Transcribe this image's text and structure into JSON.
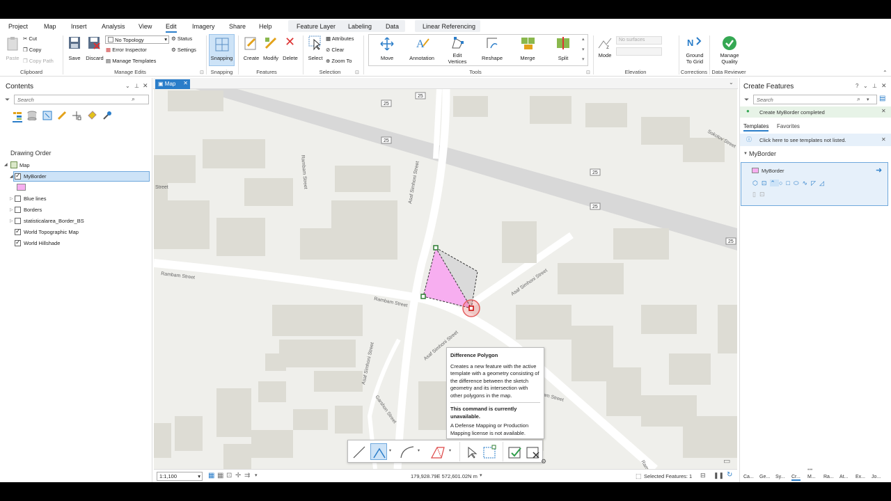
{
  "menu": {
    "tabs": [
      "Project",
      "Map",
      "Insert",
      "Analysis",
      "View",
      "Edit",
      "Imagery",
      "Share",
      "Help"
    ],
    "context_tabs": [
      "Feature Layer",
      "Labeling",
      "Data"
    ],
    "linear_referencing": "Linear Referencing"
  },
  "ribbon": {
    "clipboard": {
      "paste": "Paste",
      "cut": "Cut",
      "copy": "Copy",
      "copy_path": "Copy Path",
      "label": "Clipboard"
    },
    "manage_edits": {
      "save": "Save",
      "discard": "Discard",
      "topology": "No Topology",
      "status": "Status",
      "error_inspector": "Error Inspector",
      "settings": "Settings",
      "manage_templates": "Manage Templates",
      "label": "Manage Edits"
    },
    "snapping": {
      "button": "Snapping",
      "label": "Snapping"
    },
    "features": {
      "create": "Create",
      "modify": "Modify",
      "delete": "Delete",
      "label": "Features"
    },
    "selection": {
      "select": "Select",
      "attributes": "Attributes",
      "clear": "Clear",
      "zoom_to": "Zoom To",
      "label": "Selection"
    },
    "tools": {
      "move": "Move",
      "annotation": "Annotation",
      "edit_vertices_1": "Edit",
      "edit_vertices_2": "Vertices",
      "reshape": "Reshape",
      "merge": "Merge",
      "split": "Split",
      "label": "Tools"
    },
    "elevation": {
      "mode": "Mode",
      "surfaces": "No surfaces",
      "label": "Elevation"
    },
    "corrections": {
      "ground_1": "Ground",
      "ground_2": "To Grid",
      "label": "Corrections"
    },
    "data_reviewer": {
      "manage_1": "Manage",
      "manage_2": "Quality",
      "label": "Data Reviewer"
    }
  },
  "contents": {
    "title": "Contents",
    "search_placeholder": "Search",
    "drawing_order": "Drawing Order",
    "map": "Map",
    "layers": [
      {
        "name": "MyBorder",
        "checked": true,
        "selected": true
      },
      {
        "name": "Blue lines",
        "checked": false
      },
      {
        "name": "Borders",
        "checked": false
      },
      {
        "name": "statisticalarea_Border_BS",
        "checked": false
      },
      {
        "name": "World Topographic Map",
        "checked": true
      },
      {
        "name": "World Hillshade",
        "checked": true
      }
    ],
    "swatch_color": "#f7aef0"
  },
  "map_tab": {
    "label": "Map"
  },
  "map": {
    "streets": {
      "rambam_1": "Rambam Street",
      "rambam_2": "Rambam Street",
      "rambam_3": "Rambam Street",
      "asaf_1": "Asaf Simhoni Street",
      "asaf_2": "Asaf Simhoni Street",
      "asaf_3": "Asaf Simhoni Street",
      "asaf_4": "Asaf Simhoni Street",
      "bam_street": "bam Street",
      "street_left": "Street",
      "sokolov": "Sokolov Street",
      "garshon": "Garshon Street",
      "ram": "Ram"
    },
    "shields": [
      "25",
      "25",
      "25",
      "25",
      "25",
      "25"
    ],
    "polygon_fill": "#f7aef0"
  },
  "tooltip": {
    "title": "Difference Polygon",
    "body": "Creates a new feature with the active template with a geometry consisting of the difference between the sketch geometry and its intersection with other polygons in the map.",
    "unavailable": "This command is currently unavailable.",
    "reason": "A Defense Mapping or Production Mapping license is not available."
  },
  "status": {
    "scale": "1:1,100",
    "coords": "179,928.79E 572,601.02N m",
    "selected": "Selected Features: 1"
  },
  "create_features": {
    "title": "Create Features",
    "question": "?",
    "search_placeholder": "Search",
    "message": "Create MyBorder completed",
    "tab_templates": "Templates",
    "tab_favorites": "Favorites",
    "info": "Click here to see templates not listed.",
    "group": "MyBorder",
    "template": "MyBorder"
  },
  "bottom_tabs": [
    "Ca...",
    "Ge...",
    "Sy...",
    "Cr...",
    "M...",
    "Ra...",
    "At...",
    "Ex...",
    "Jo..."
  ]
}
